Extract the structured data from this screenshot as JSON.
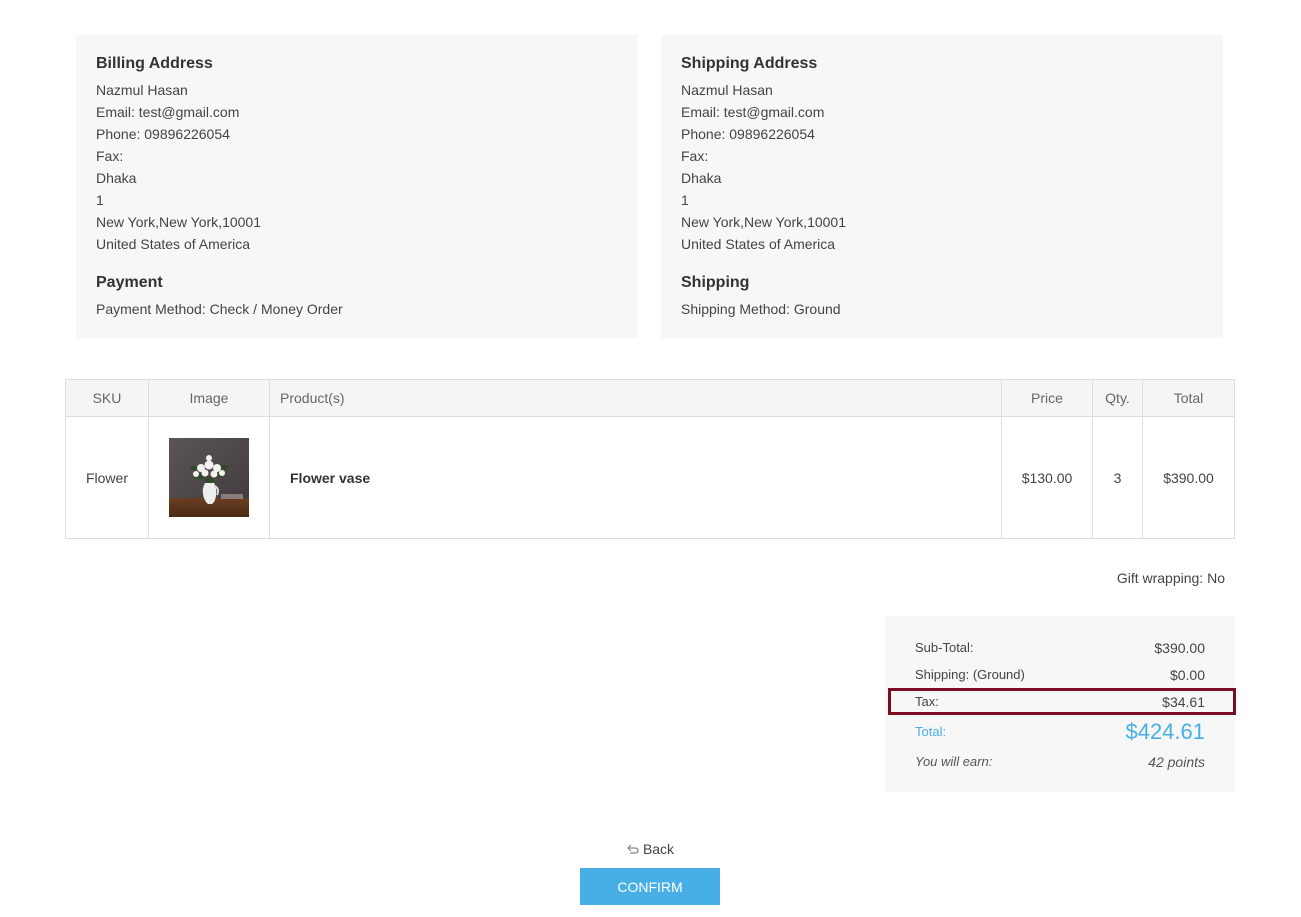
{
  "billing": {
    "title": "Billing Address",
    "name": "Nazmul Hasan",
    "email": "Email: test@gmail.com",
    "phone": "Phone: 09896226054",
    "fax": "Fax:",
    "address1": "Dhaka",
    "address2": "1",
    "city_state_zip": "New York,New York,10001",
    "country": "United States of America"
  },
  "payment": {
    "title": "Payment",
    "method": "Payment Method: Check / Money Order"
  },
  "shipping_address": {
    "title": "Shipping Address",
    "name": "Nazmul Hasan",
    "email": "Email: test@gmail.com",
    "phone": "Phone: 09896226054",
    "fax": "Fax:",
    "address1": "Dhaka",
    "address2": "1",
    "city_state_zip": "New York,New York,10001",
    "country": "United States of America"
  },
  "shipping": {
    "title": "Shipping",
    "method": "Shipping Method: Ground"
  },
  "table": {
    "headers": {
      "sku": "SKU",
      "image": "Image",
      "products": "Product(s)",
      "price": "Price",
      "qty": "Qty.",
      "total": "Total"
    },
    "rows": [
      {
        "sku": "Flower",
        "image_icon": "flower-vase-photo",
        "product": "Flower vase",
        "price": "$130.00",
        "qty": "3",
        "total": "$390.00"
      }
    ]
  },
  "gift_wrapping": "Gift wrapping: No",
  "totals": {
    "subtotal_label": "Sub-Total:",
    "subtotal_value": "$390.00",
    "shipping_label": "Shipping: (Ground)",
    "shipping_value": "$0.00",
    "tax_label": "Tax:",
    "tax_value": "$34.61",
    "total_label": "Total:",
    "total_value": "$424.61",
    "earn_label": "You will earn:",
    "earn_value": "42 points"
  },
  "actions": {
    "back_label": "Back",
    "back_icon": "return-arrow-icon",
    "confirm_label": "CONFIRM"
  },
  "colors": {
    "accent": "#48aee6",
    "highlight_border": "#7a0d22",
    "panel_bg": "#f7f7f7"
  }
}
